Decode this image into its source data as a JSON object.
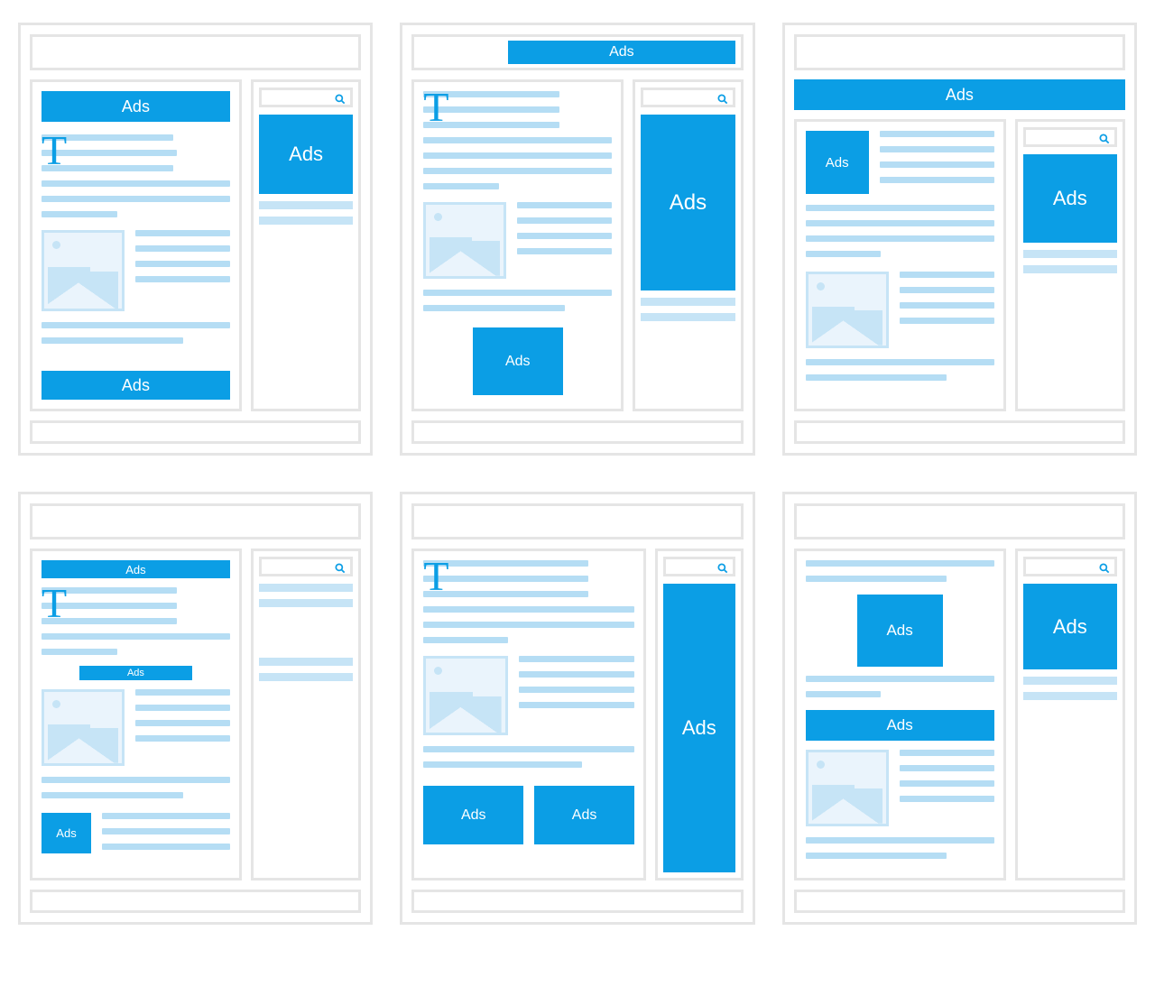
{
  "ad_label": "Ads",
  "layouts": [
    {
      "id": "layout-1-top-banner-side-square-bottom-banner"
    },
    {
      "id": "layout-2-above-header-banner-tall-side-mid-square"
    },
    {
      "id": "layout-3-under-header-banner-small-inline-side-square"
    },
    {
      "id": "layout-4-slim-top-banner-inline-strip-small-square"
    },
    {
      "id": "layout-5-skyscraper-side-two-bottom-squares"
    },
    {
      "id": "layout-6-centered-square-wide-mid-banner-side-square"
    }
  ]
}
